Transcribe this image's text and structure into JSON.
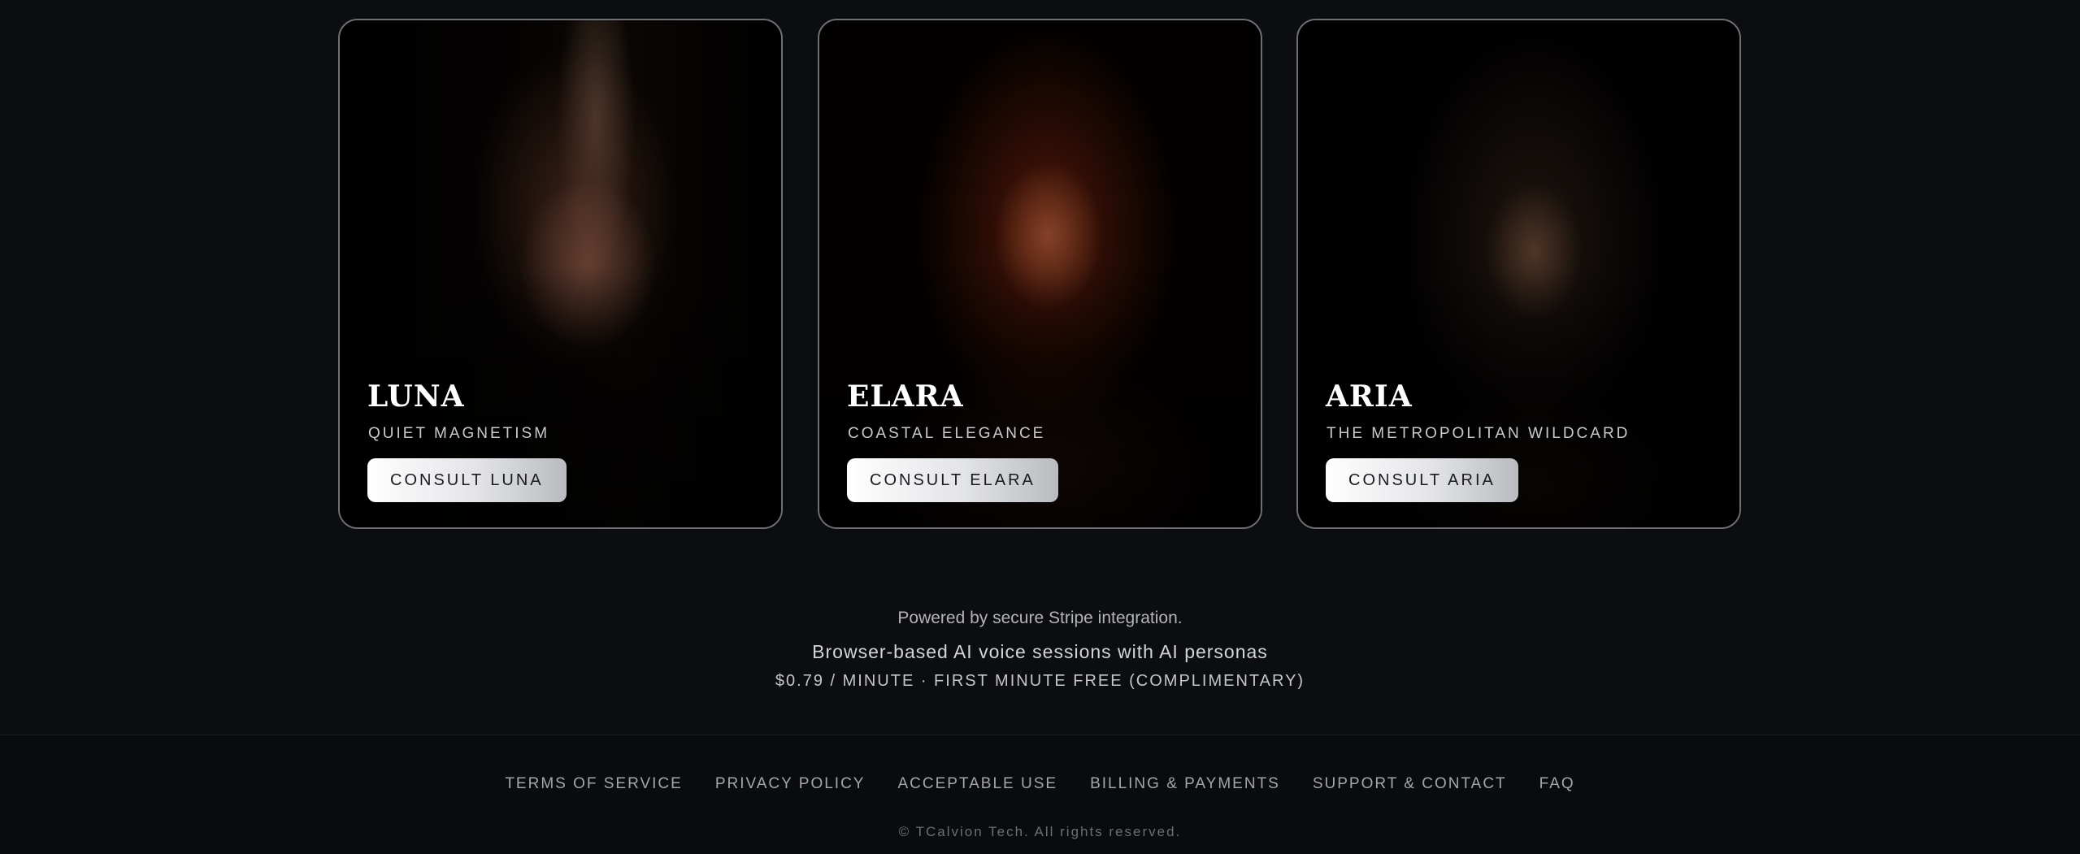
{
  "personas": [
    {
      "name": "LUNA",
      "tagline": "QUIET MAGNETISM",
      "button_label": "CONSULT LUNA"
    },
    {
      "name": "ELARA",
      "tagline": "COASTAL ELEGANCE",
      "button_label": "CONSULT ELARA"
    },
    {
      "name": "ARIA",
      "tagline": "THE METROPOLITAN WILDCARD",
      "button_label": "CONSULT ARIA"
    }
  ],
  "info": {
    "powered_by": "Powered by secure Stripe integration.",
    "subtitle": "Browser-based AI voice sessions with AI personas",
    "pricing": "$0.79 / MINUTE · FIRST MINUTE FREE (COMPLIMENTARY)"
  },
  "footer": {
    "links": [
      "TERMS OF SERVICE",
      "PRIVACY POLICY",
      "ACCEPTABLE USE",
      "BILLING & PAYMENTS",
      "SUPPORT & CONTACT",
      "FAQ"
    ],
    "copyright": "© TCalvion Tech. All rights reserved."
  },
  "colors": {
    "background": "#0c0d10",
    "card_border": "#6e7075",
    "button_gradient_start": "#ffffff",
    "button_gradient_end": "#b9bbc0"
  }
}
